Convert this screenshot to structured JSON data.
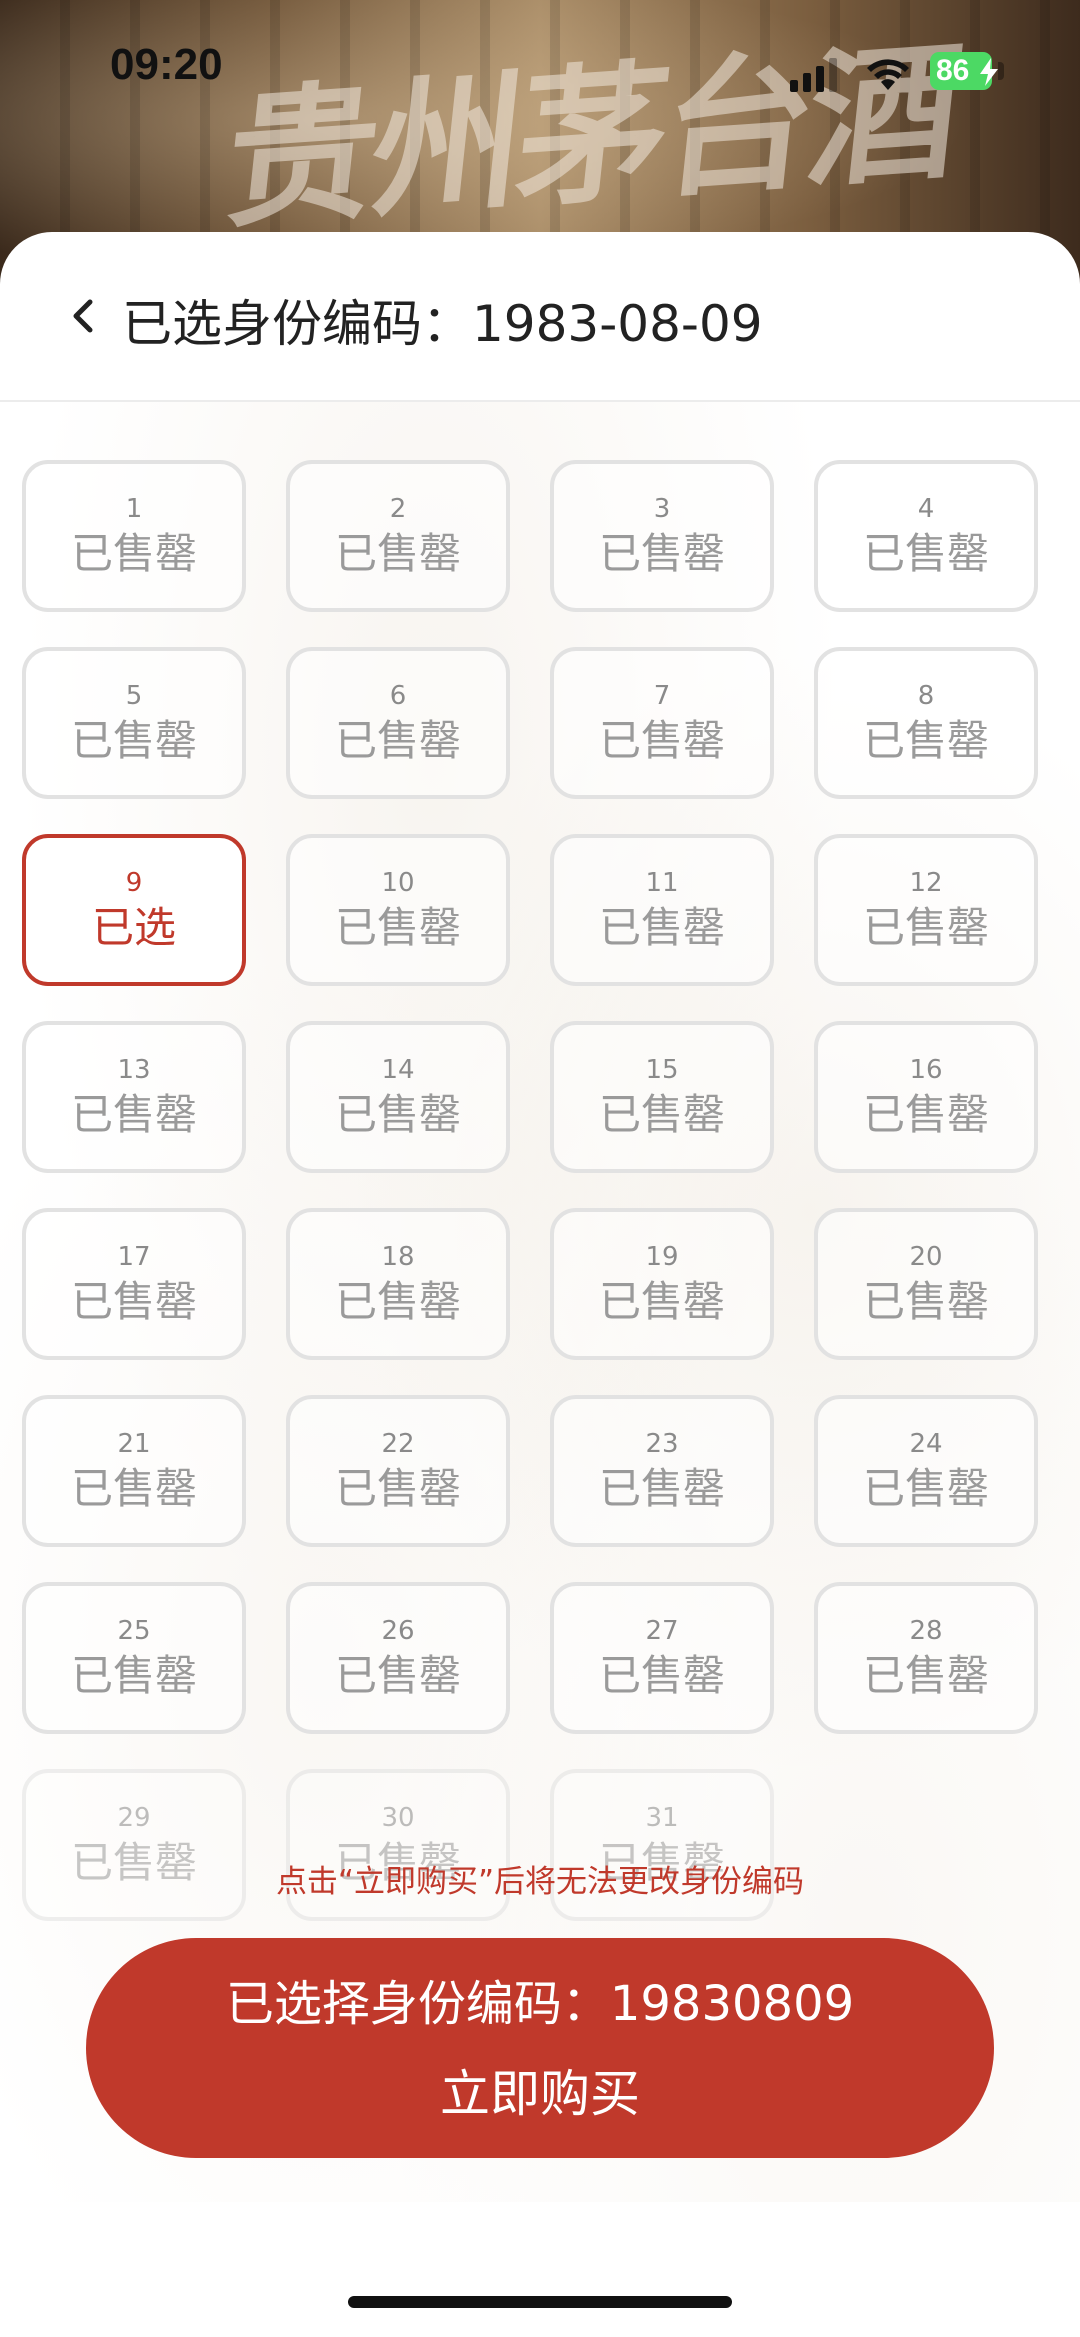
{
  "status_bar": {
    "time": "09:20",
    "battery": "86"
  },
  "banner": {
    "calligraphy": "贵州茅台酒"
  },
  "header": {
    "title": "已选身份编码：1983-08-09"
  },
  "slots": [
    {
      "num": "1",
      "status": "已售罄"
    },
    {
      "num": "2",
      "status": "已售罄"
    },
    {
      "num": "3",
      "status": "已售罄"
    },
    {
      "num": "4",
      "status": "已售罄"
    },
    {
      "num": "5",
      "status": "已售罄"
    },
    {
      "num": "6",
      "status": "已售罄"
    },
    {
      "num": "7",
      "status": "已售罄"
    },
    {
      "num": "8",
      "status": "已售罄"
    },
    {
      "num": "9",
      "status": "已选"
    },
    {
      "num": "10",
      "status": "已售罄"
    },
    {
      "num": "11",
      "status": "已售罄"
    },
    {
      "num": "12",
      "status": "已售罄"
    },
    {
      "num": "13",
      "status": "已售罄"
    },
    {
      "num": "14",
      "status": "已售罄"
    },
    {
      "num": "15",
      "status": "已售罄"
    },
    {
      "num": "16",
      "status": "已售罄"
    },
    {
      "num": "17",
      "status": "已售罄"
    },
    {
      "num": "18",
      "status": "已售罄"
    },
    {
      "num": "19",
      "status": "已售罄"
    },
    {
      "num": "20",
      "status": "已售罄"
    },
    {
      "num": "21",
      "status": "已售罄"
    },
    {
      "num": "22",
      "status": "已售罄"
    },
    {
      "num": "23",
      "status": "已售罄"
    },
    {
      "num": "24",
      "status": "已售罄"
    },
    {
      "num": "25",
      "status": "已售罄"
    },
    {
      "num": "26",
      "status": "已售罄"
    },
    {
      "num": "27",
      "status": "已售罄"
    },
    {
      "num": "28",
      "status": "已售罄"
    },
    {
      "num": "29",
      "status": "已售罄"
    },
    {
      "num": "30",
      "status": "已售罄"
    },
    {
      "num": "31",
      "status": "已售罄"
    }
  ],
  "selected_index": 8,
  "notice": "点击“立即购买”后将无法更改身份编码",
  "buy_button": {
    "line1": "已选择身份编码：19830809",
    "line2": "立即购买"
  },
  "colors": {
    "accent": "#c0392b",
    "battery": "#4cd964",
    "cell_border": "#e2e2e2",
    "sold_out_text": "#9a9a9a"
  }
}
